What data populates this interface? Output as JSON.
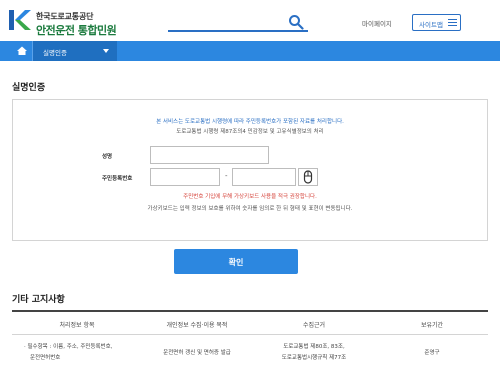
{
  "header": {
    "org_name": "한국도로교통공단",
    "site_name": "안전운전 통합민원",
    "my_page": "마이페이지",
    "sitemap": "사이트맵"
  },
  "nav": {
    "dropdown_label": "실명인증"
  },
  "page": {
    "title": "실명인증"
  },
  "form": {
    "notice_1": "본 서비스는 도로교통법 시행령에 따라 주민등록번호가 포함된 자료를 처리합니다.",
    "notice_2": "도로교통법 시행령 제87조의4 민감정보 및 고유식별정보의 처리",
    "name_label": "성명",
    "name_value": "",
    "rrn_label": "주민등록번호",
    "rrn_front_value": "",
    "rrn_dash": "-",
    "rrn_back_value": "",
    "warning": "주민번호 기입에 무해 가상키보드 사용을 적극 권장합니다.",
    "notice_3": "가상키보드는 입력 정보의 보호를 위하여 숫자를 임의로 한 뒤 형태 및 표현이 변동됩니다."
  },
  "confirm": {
    "label": "확인"
  },
  "other": {
    "title": "기타 고지사항",
    "headers": [
      "처리정보 항목",
      "개인정보 수집·이용 목적",
      "수집근거",
      "보유기간"
    ],
    "row": {
      "item_line1": "· 필수항목 : 이름, 주소, 주민등록번호,",
      "item_line2": "운전면허번호",
      "purpose": "운전면허 갱신 및 면허증 발급",
      "basis_line1": "도로교통법 제80조, 83조,",
      "basis_line2": "도로교통법시행규칙 제77조",
      "period": "준영구"
    }
  },
  "colors": {
    "brand_blue": "#2c87e0",
    "brand_green": "#1a7a3d",
    "warning_red": "#d6453d"
  },
  "icons": [
    "logo-mark",
    "search-icon",
    "hamburger-icon",
    "home-icon",
    "chevron-down-icon",
    "mouse-icon"
  ]
}
